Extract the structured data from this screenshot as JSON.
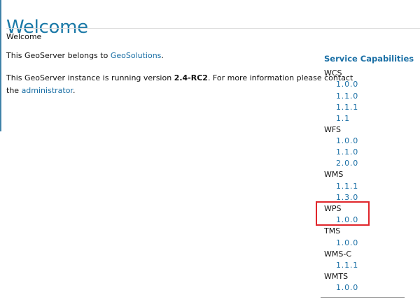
{
  "page": {
    "title": "Welcome",
    "subtitle": "Welcome"
  },
  "owner": {
    "prefix": "This GeoServer belongs to ",
    "link": "GeoSolutions",
    "suffix": "."
  },
  "version_info": {
    "prefix": "This GeoServer instance is running version ",
    "version": "2.4-RC2",
    "middle": ". For more information please contact",
    "line2_prefix": "the ",
    "admin_link": "administrator",
    "line2_suffix": "."
  },
  "service_capabilities": {
    "heading": "Service Capabilities",
    "services": [
      {
        "name": "WCS",
        "versions": [
          "1.0.0",
          "1.1.0",
          "1.1.1",
          "1.1"
        ]
      },
      {
        "name": "WFS",
        "versions": [
          "1.0.0",
          "1.1.0",
          "2.0.0"
        ]
      },
      {
        "name": "WMS",
        "versions": [
          "1.1.1",
          "1.3.0"
        ]
      },
      {
        "name": "WPS",
        "versions": [
          "1.0.0"
        ]
      },
      {
        "name": "TMS",
        "versions": [
          "1.0.0"
        ]
      },
      {
        "name": "WMS-C",
        "versions": [
          "1.1.1"
        ]
      },
      {
        "name": "WMTS",
        "versions": [
          "1.0.0"
        ]
      }
    ]
  },
  "highlight": {
    "service": "WPS",
    "color": "#e0262b"
  },
  "colors": {
    "accent": "#1a6fa5",
    "title": "#1b79a7"
  }
}
